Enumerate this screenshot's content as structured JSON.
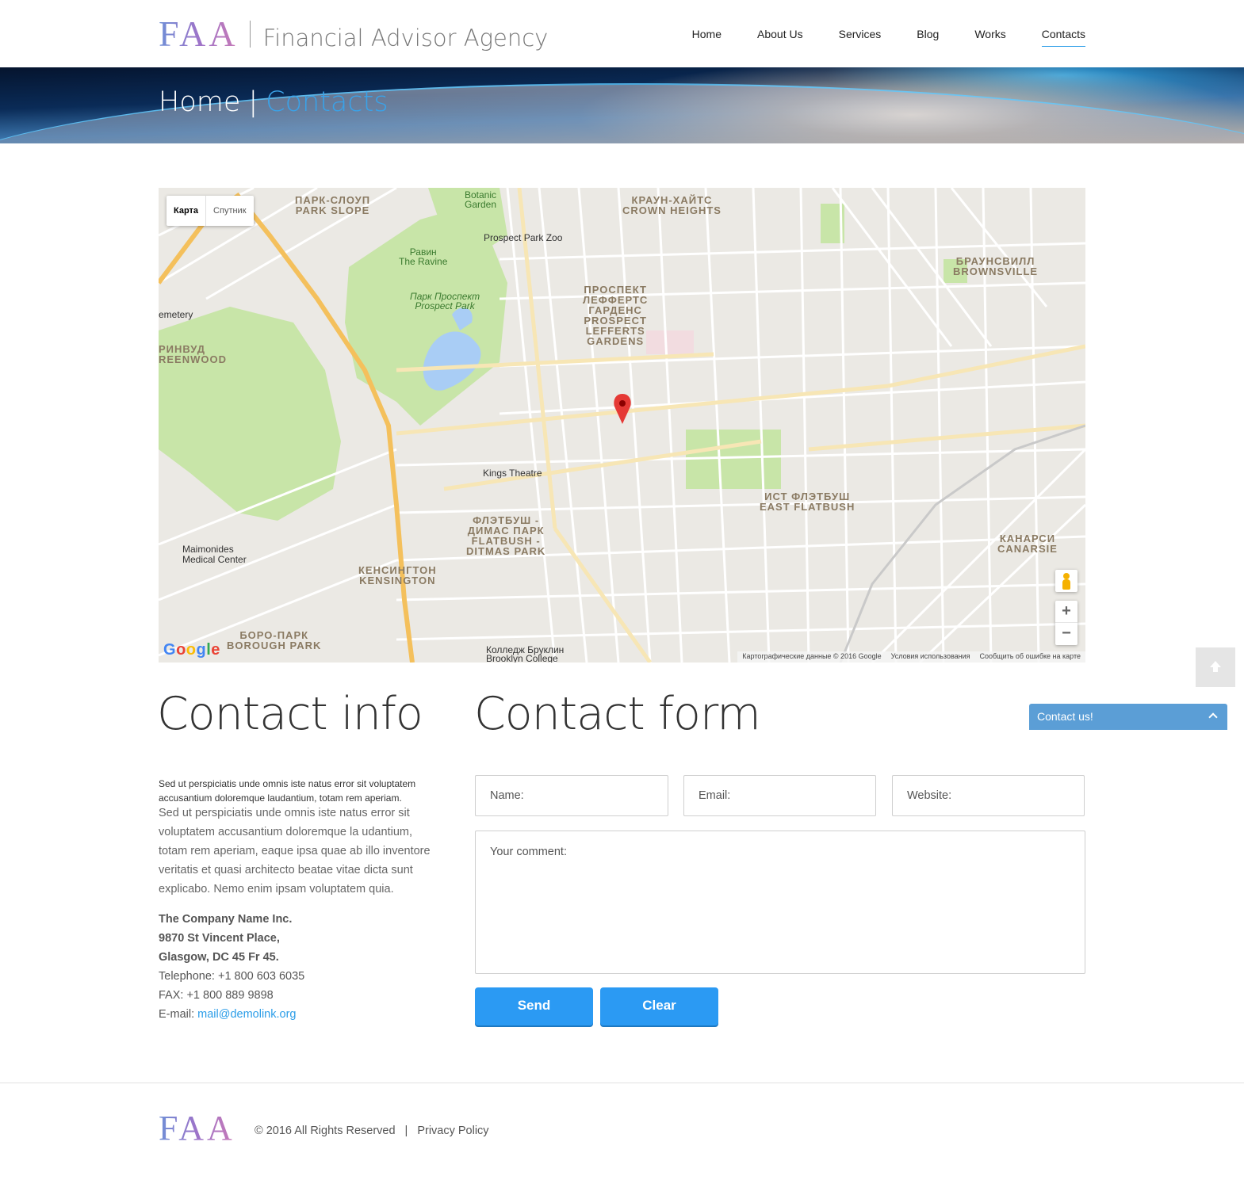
{
  "header": {
    "logo_mark": "FAA",
    "logo_text": "Financial Advisor Agency",
    "nav": [
      "Home",
      "About Us",
      "Services",
      "Blog",
      "Works",
      "Contacts"
    ],
    "active_nav": "Contacts"
  },
  "banner": {
    "crumb_home": "Home",
    "separator": "|",
    "crumb_current": "Contacts"
  },
  "map": {
    "type_map": "Карта",
    "type_satellite": "Спутник",
    "zoom_in": "+",
    "zoom_out": "−",
    "google": [
      "G",
      "o",
      "o",
      "g",
      "l",
      "e"
    ],
    "footer": [
      "Картографические данные © 2016 Google",
      "Условия использования",
      "Сообщить об ошибке на карте"
    ],
    "labels": {
      "park_slope": "ПАРК-СЛОУП\nPARK SLOPE",
      "crown_heights": "КРАУН-ХАЙТС\nCROWN HEIGHTS",
      "brownsville": "БРАУНСВИЛЛ\nBROWNSVILLE",
      "lefferts": "ПРОСПЕКТ\nЛЕФФЕРТС\nГАРДЕНС\nPROSPECT\nLEFFERTS\nGARDENS",
      "greenwood": "РИНВУД\nREENWOOD",
      "east_flatbush": "ИСТ ФЛЭТБУШ\nEAST FLATBUSH",
      "ditmas": "ФЛЭТБУШ -\nДИМАС ПАРК\nFLATBUSH -\nDITMAS PARK",
      "kensington": "КЕНСИНГТОН\nKENSINGTON",
      "borough_park": "БОРО-ПАРК\nBOROUGH PARK",
      "canarsie": "КАНАРСИ\nCANARSIE",
      "botanic": "Botanic\nGarden",
      "prospect_zoo": "Prospect Park Zoo",
      "ravine": "Равин\nThe Ravine",
      "prospect_park": "Парк Проспект\nProspect Park",
      "kings_theatre": "Kings Theatre",
      "maimonides": "Maimonides\nMedical Center",
      "brooklyn_college": "Колледж Бруклин\nBrooklyn College",
      "cemetery": "emetery"
    }
  },
  "widgets": {
    "contact_us": "Contact us!"
  },
  "info": {
    "heading": "Contact info",
    "lead": "Sed ut perspiciatis unde omnis iste natus error sit voluptatem accusantium doloremque laudantium, totam rem aperiam.",
    "body": "Sed ut perspiciatis unde omnis iste natus error sit voluptatem accusantium doloremque la udantium, totam rem aperiam, eaque ipsa quae ab illo inventore veritatis et quasi architecto beatae vitae dicta sunt explicabo. Nemo enim ipsam voluptatem quia.",
    "company": "The Company Name Inc.",
    "street": "9870 St Vincent Place,",
    "city": "Glasgow, DC 45 Fr 45.",
    "telephone": "Telephone: +1 800 603 6035",
    "fax": "FAX: +1 800 889 9898",
    "email_label": "E-mail: ",
    "email": "mail@demolink.org"
  },
  "form": {
    "heading": "Contact form",
    "name_placeholder": "Name:",
    "email_placeholder": "Email:",
    "website_placeholder": "Website:",
    "comment_placeholder": "Your comment:",
    "send": "Send",
    "clear": "Clear"
  },
  "footer": {
    "logo_mark": "FAA",
    "copyright": "© 2016 All Rights Reserved",
    "separator": "|",
    "privacy": "Privacy Policy"
  },
  "colors": {
    "accent": "#2b9de8",
    "button": "#2b9af3",
    "contact_us_bg": "#5b9ed6",
    "park_green": "#c8e5a8"
  }
}
